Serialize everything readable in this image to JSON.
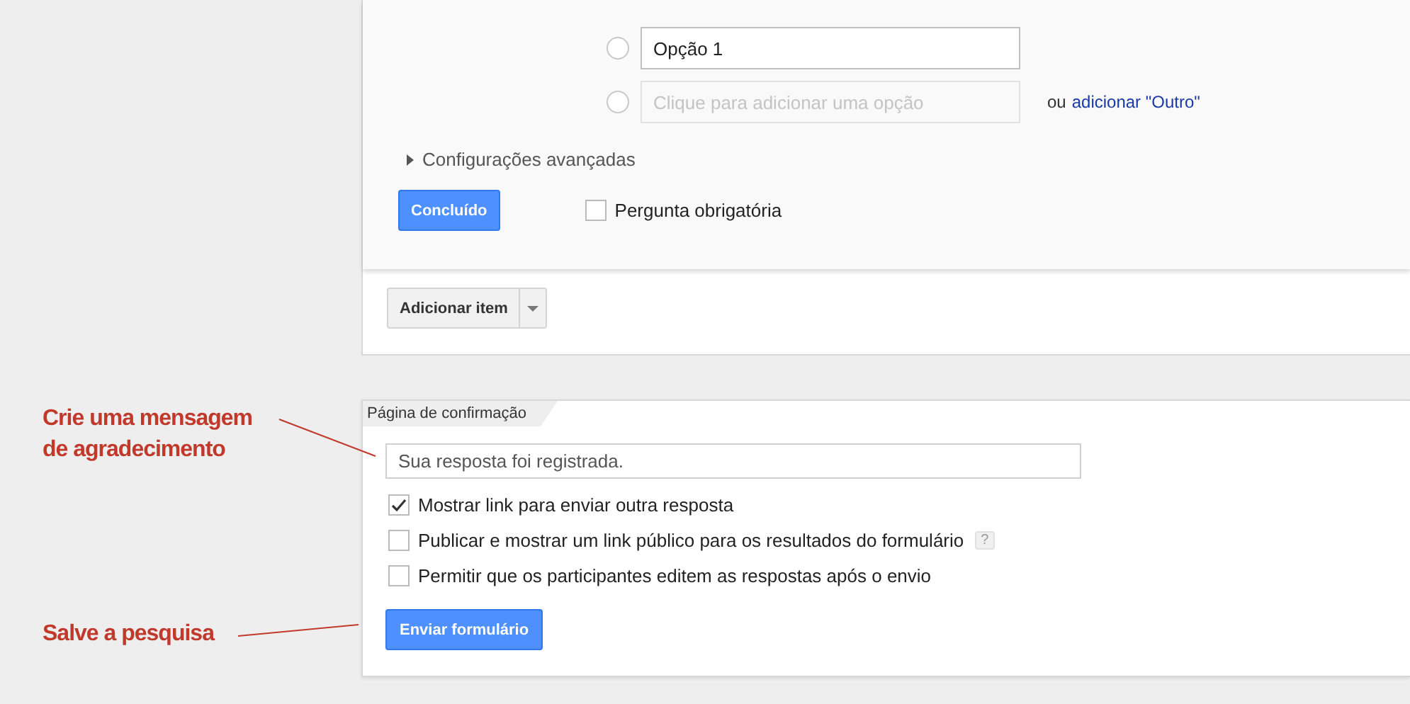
{
  "question": {
    "options": [
      {
        "value": "Opção 1",
        "selected": false
      }
    ],
    "new_option": {
      "placeholder": "Clique para adicionar uma opção",
      "selected": false
    },
    "other_prefix": "ou",
    "other_link": "adicionar \"Outro\"",
    "advanced": {
      "label": "Configurações avançadas",
      "expanded": false
    },
    "done_button": "Concluído",
    "required": {
      "label": "Pergunta obrigatória",
      "checked": false
    }
  },
  "add_item": {
    "label": "Adicionar item"
  },
  "confirmation": {
    "tab": "Página de confirmação",
    "message": "Sua resposta foi registrada.",
    "options": [
      {
        "label": "Mostrar link para enviar outra resposta",
        "checked": true
      },
      {
        "label": "Publicar e mostrar um link público para os resultados do formulário",
        "checked": false,
        "help_text": "?"
      },
      {
        "label": "Permitir que os participantes editem as respostas após o envio",
        "checked": false
      }
    ],
    "submit_button": "Enviar formulário"
  },
  "annotations": [
    {
      "text": "Crie uma mensagem de agradecimento"
    },
    {
      "text": "Salve a pesquisa"
    }
  ]
}
